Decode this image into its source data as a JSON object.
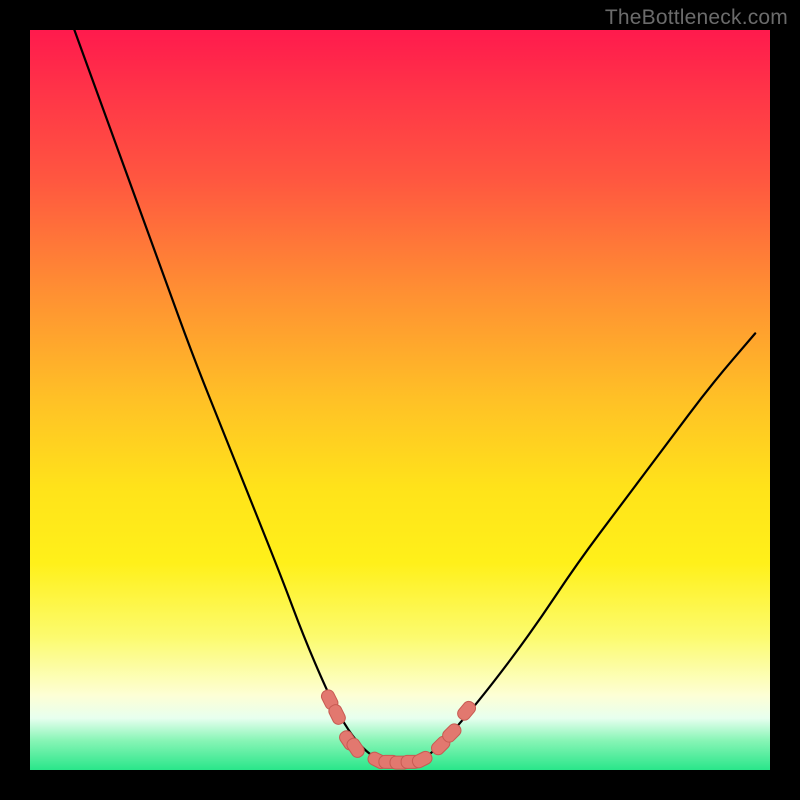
{
  "watermark": {
    "text": "TheBottleneck.com"
  },
  "chart_data": {
    "type": "line",
    "title": "",
    "xlabel": "",
    "ylabel": "",
    "xlim": [
      0,
      100
    ],
    "ylim": [
      0,
      100
    ],
    "grid": false,
    "legend": false,
    "series": [
      {
        "name": "bottleneck-curve",
        "x": [
          6,
          10,
          14,
          18,
          22,
          26,
          30,
          34,
          37,
          40,
          42,
          44,
          46,
          48,
          50,
          52,
          54,
          57,
          62,
          68,
          74,
          80,
          86,
          92,
          98
        ],
        "values": [
          100,
          89,
          78,
          67,
          56,
          46,
          36,
          26,
          18,
          11,
          7,
          4,
          2,
          1,
          1,
          1,
          2,
          5,
          11,
          19,
          28,
          36,
          44,
          52,
          59
        ]
      }
    ],
    "markers": [
      {
        "x": 40.5,
        "y": 9.5
      },
      {
        "x": 41.5,
        "y": 7.5
      },
      {
        "x": 43.0,
        "y": 4.0
      },
      {
        "x": 44.0,
        "y": 3.0
      },
      {
        "x": 47.0,
        "y": 1.3
      },
      {
        "x": 48.5,
        "y": 1.1
      },
      {
        "x": 50.0,
        "y": 1.0
      },
      {
        "x": 51.5,
        "y": 1.1
      },
      {
        "x": 53.0,
        "y": 1.4
      },
      {
        "x": 55.5,
        "y": 3.3
      },
      {
        "x": 57.0,
        "y": 5.0
      },
      {
        "x": 59.0,
        "y": 8.0
      }
    ],
    "colors": {
      "curve": "#000000",
      "marker_fill": "#e2786f",
      "marker_stroke": "#c75a52"
    }
  }
}
